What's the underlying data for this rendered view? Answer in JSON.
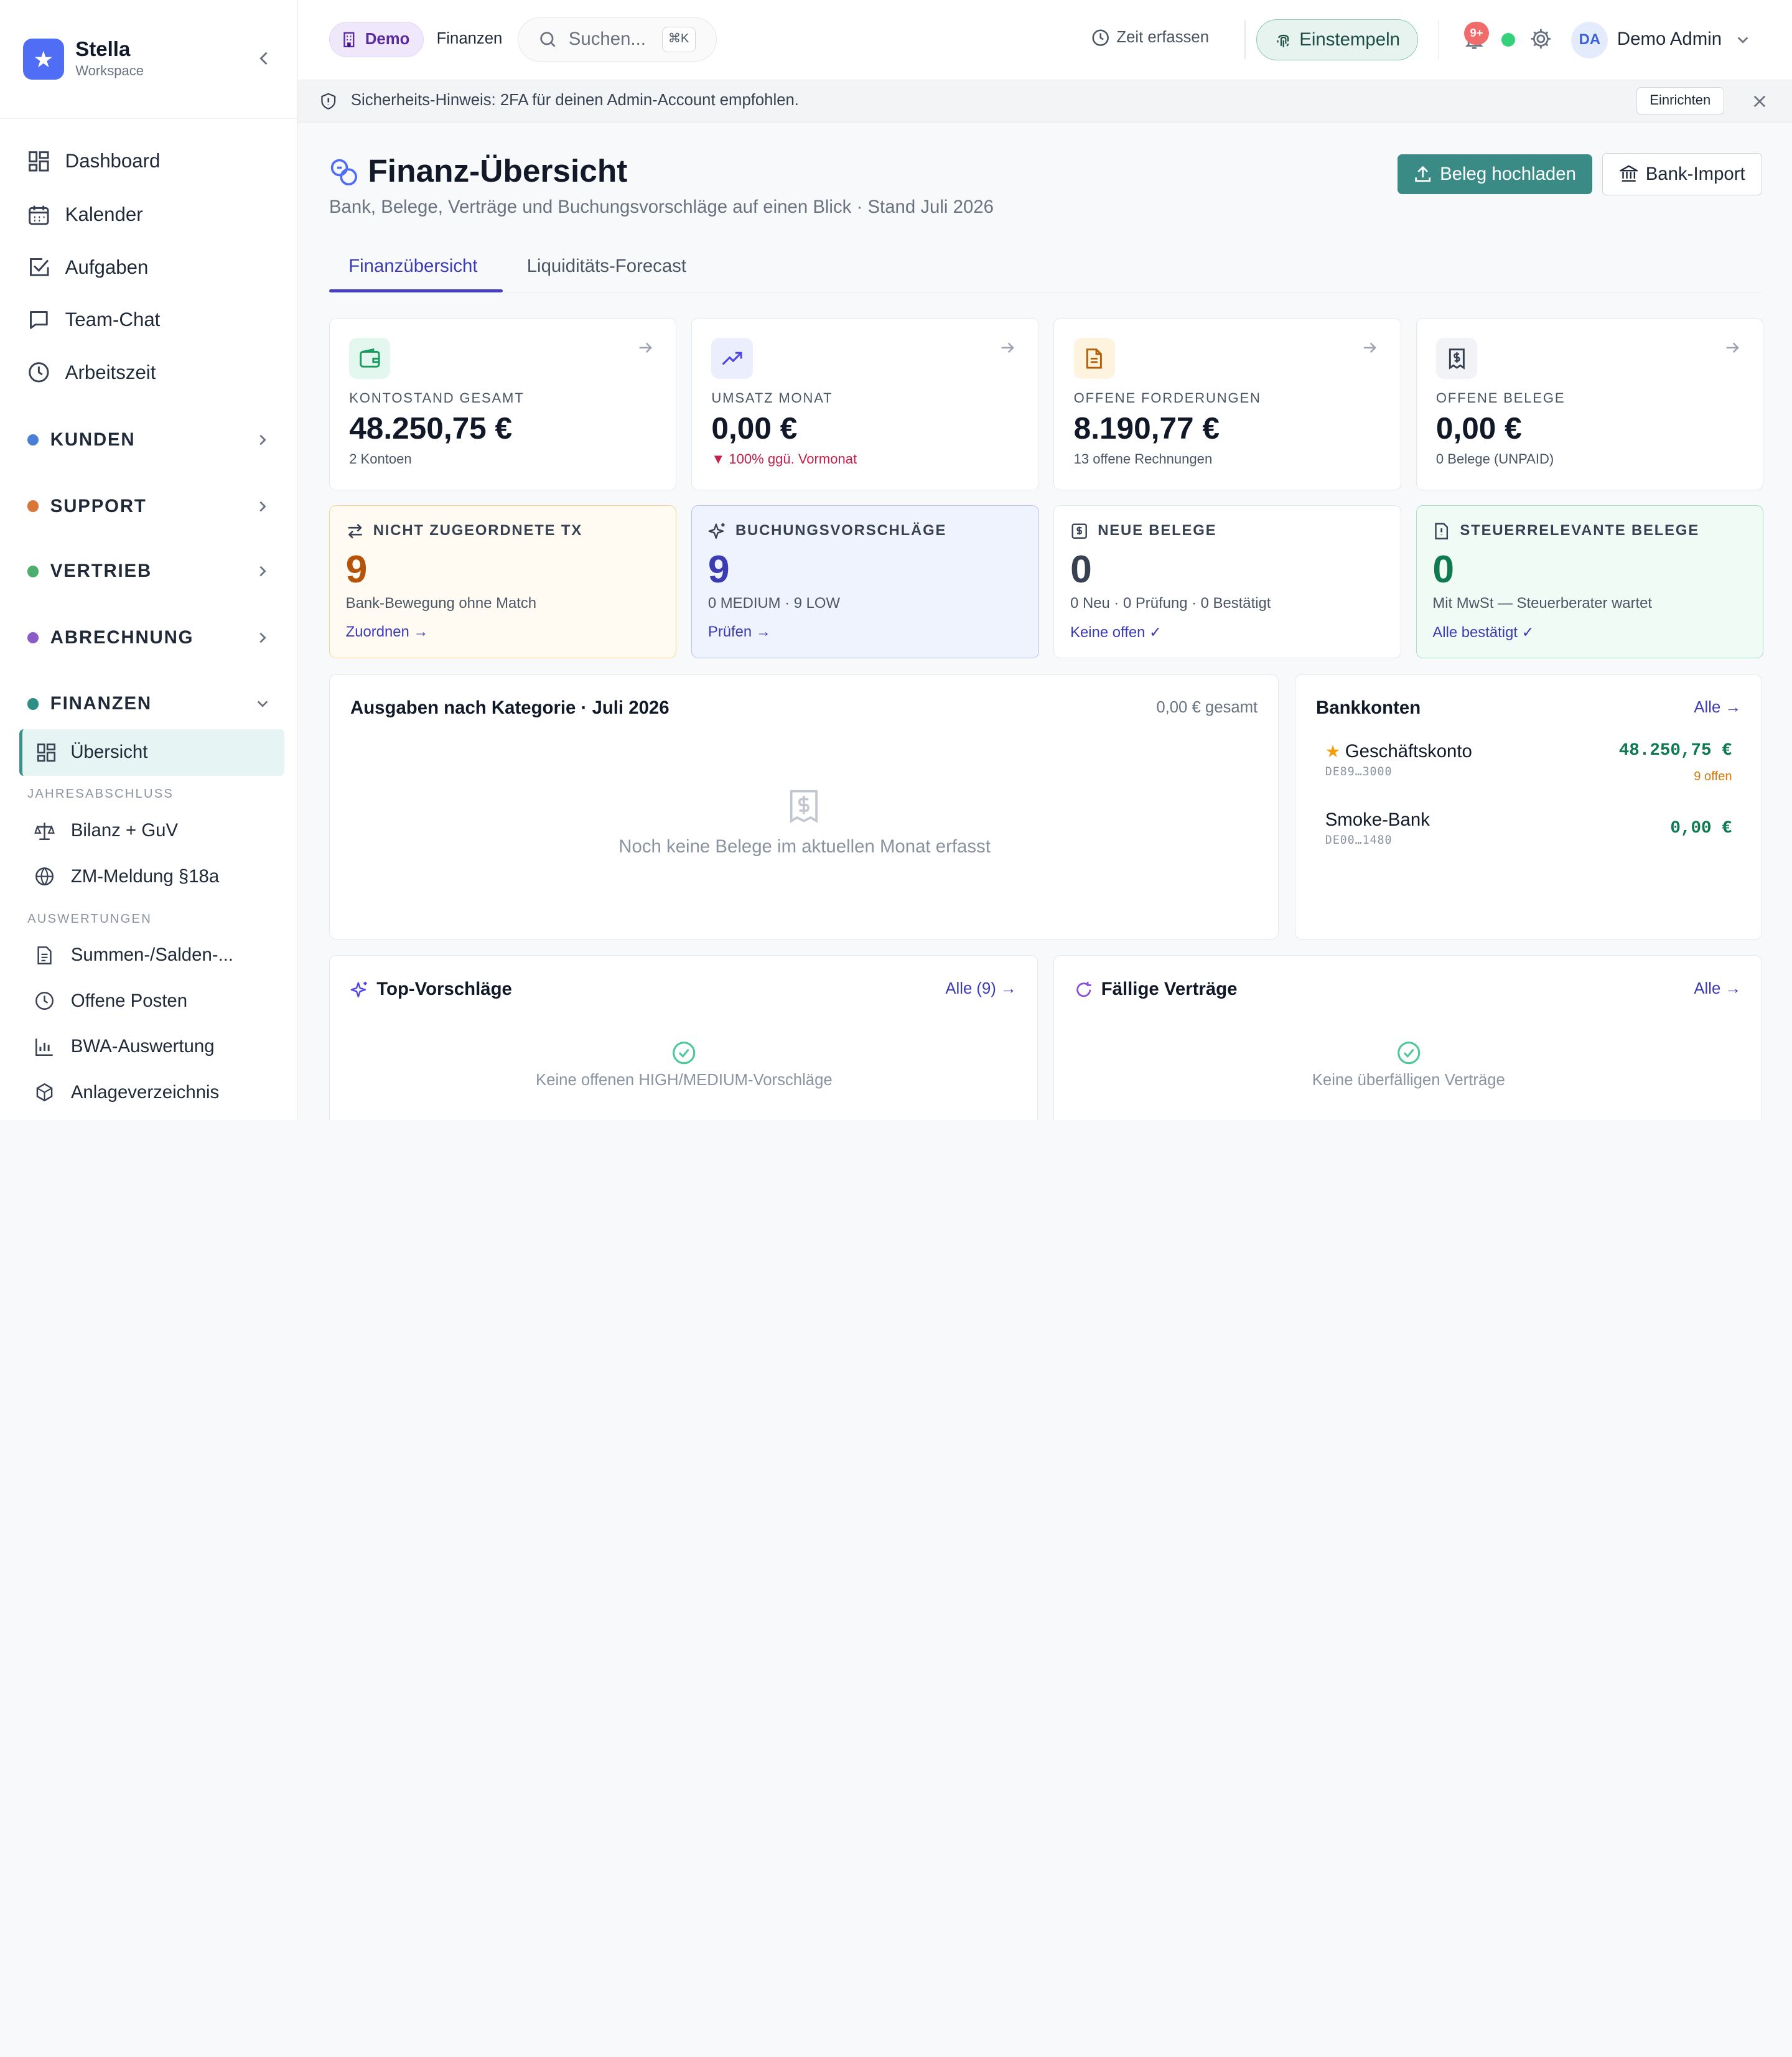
{
  "brand": {
    "name": "Stella",
    "sub": "Workspace"
  },
  "sidebar": {
    "nav": [
      {
        "label": "Dashboard",
        "icon": "grid-icon"
      },
      {
        "label": "Kalender",
        "icon": "calendar-icon"
      },
      {
        "label": "Aufgaben",
        "icon": "checkbox-icon"
      },
      {
        "label": "Team-Chat",
        "icon": "chat-icon"
      },
      {
        "label": "Arbeitszeit",
        "icon": "clock-icon"
      }
    ],
    "groups": [
      {
        "label": "KUNDEN",
        "color": "#4a7fd6"
      },
      {
        "label": "SUPPORT",
        "color": "#d97736"
      },
      {
        "label": "VERTRIEB",
        "color": "#4caf6e"
      },
      {
        "label": "ABRECHNUNG",
        "color": "#8a5cc8"
      },
      {
        "label": "FINANZEN",
        "color": "#2e8f87"
      }
    ],
    "active": "Übersicht",
    "section1": "JAHRESABSCHLUSS",
    "section1_items": [
      "Bilanz + GuV",
      "ZM-Meldung §18a"
    ],
    "section2": "AUSWERTUNGEN",
    "section2_items": [
      "Summen-/Salden-...",
      "Offene Posten",
      "BWA-Auswertung",
      "Anlageverzeichnis"
    ]
  },
  "topbar": {
    "demo": "Demo",
    "crumb": "Finanzen",
    "search_placeholder": "Suchen...",
    "kbd": "⌘K",
    "time": "Zeit erfassen",
    "clockin": "Einstempeln",
    "badge": "9+",
    "avatar": "DA",
    "user": "Demo Admin"
  },
  "banner": {
    "text": "Sicherheits-Hinweis: 2FA für deinen Admin-Account empfohlen.",
    "button": "Einrichten"
  },
  "page": {
    "title": "Finanz-Übersicht",
    "subtitle": "Bank, Belege, Verträge und Buchungsvorschläge auf einen Blick · Stand Juli 2026",
    "upload": "Beleg hochladen",
    "bank_import": "Bank-Import",
    "tabs": [
      "Finanzübersicht",
      "Liquiditäts-Forecast"
    ]
  },
  "kpis": [
    {
      "label": "KONTOSTAND GESAMT",
      "value": "48.250,75 €",
      "sub": "2 Kontoen"
    },
    {
      "label": "UMSATZ MONAT",
      "value": "0,00 €",
      "sub": "▼ 100% ggü. Vormonat"
    },
    {
      "label": "OFFENE FORDERUNGEN",
      "value": "8.190,77 €",
      "sub": "13 offene Rechnungen"
    },
    {
      "label": "OFFENE BELEGE",
      "value": "0,00 €",
      "sub": "0 Belege (UNPAID)"
    }
  ],
  "stats": [
    {
      "label": "NICHT ZUGEORDNETE TX",
      "value": "9",
      "sub": "Bank-Bewegung ohne Match",
      "link": "Zuordnen →"
    },
    {
      "label": "BUCHUNGSVORSCHLÄGE",
      "value": "9",
      "sub": "0 MEDIUM · 9 LOW",
      "link": "Prüfen →"
    },
    {
      "label": "NEUE BELEGE",
      "value": "0",
      "sub": "0 Neu · 0 Prüfung · 0 Bestätigt",
      "link": "Keine offen ✓"
    },
    {
      "label": "STEUERRELEVANTE BELEGE",
      "value": "0",
      "sub": "Mit MwSt — Steuerberater wartet",
      "link": "Alle bestätigt ✓"
    }
  ],
  "expenses": {
    "title": "Ausgaben nach Kategorie · Juli 2026",
    "total": "0,00 € gesamt",
    "empty": "Noch keine Belege im aktuellen Monat erfasst"
  },
  "bank": {
    "title": "Bankkonten",
    "link": "Alle →",
    "accounts": [
      {
        "name": "Geschäftskonto",
        "iban": "DE89…3000",
        "balance": "48.250,75 €",
        "open": "9 offen"
      },
      {
        "name": "Smoke-Bank",
        "iban": "DE00…1480",
        "balance": "0,00 €"
      }
    ]
  },
  "top": {
    "title": "Top-Vorschläge",
    "link": "Alle (9) →",
    "empty": "Keine offenen HIGH/MEDIUM-Vorschläge"
  },
  "contracts": {
    "title": "Fällige Verträge",
    "link": "Alle →",
    "empty": "Keine überfälligen Verträge"
  }
}
